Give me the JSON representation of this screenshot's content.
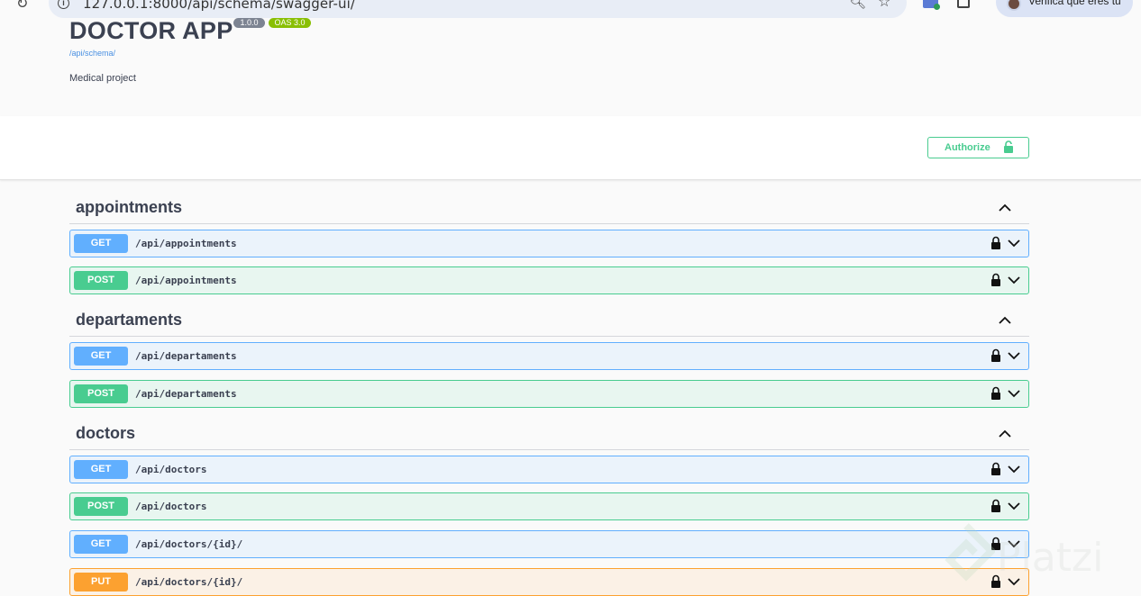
{
  "browser": {
    "url": "127.0.0.1:8000/api/schema/swagger-ui/",
    "profile_text": "Verifica que eres tú"
  },
  "info": {
    "title": "DOCTOR APP",
    "version_badge": "1.0.0",
    "oas_badge": "OAS 3.0",
    "schema_link": "/api/schema/",
    "description": "Medical project"
  },
  "authorize": {
    "label": "Authorize"
  },
  "tags": [
    {
      "name": "appointments",
      "operations": [
        {
          "method": "GET",
          "path": "/api/appointments"
        },
        {
          "method": "POST",
          "path": "/api/appointments"
        }
      ]
    },
    {
      "name": "departaments",
      "operations": [
        {
          "method": "GET",
          "path": "/api/departaments"
        },
        {
          "method": "POST",
          "path": "/api/departaments"
        }
      ]
    },
    {
      "name": "doctors",
      "operations": [
        {
          "method": "GET",
          "path": "/api/doctors"
        },
        {
          "method": "POST",
          "path": "/api/doctors"
        },
        {
          "method": "GET",
          "path": "/api/doctors/{id}/"
        },
        {
          "method": "PUT",
          "path": "/api/doctors/{id}/"
        }
      ]
    }
  ],
  "watermark": "Platzi",
  "colors": {
    "get": "#61affe",
    "post": "#49cc90",
    "put": "#fca130",
    "oas_badge": "#89bf04",
    "version_badge": "#7d8492"
  }
}
